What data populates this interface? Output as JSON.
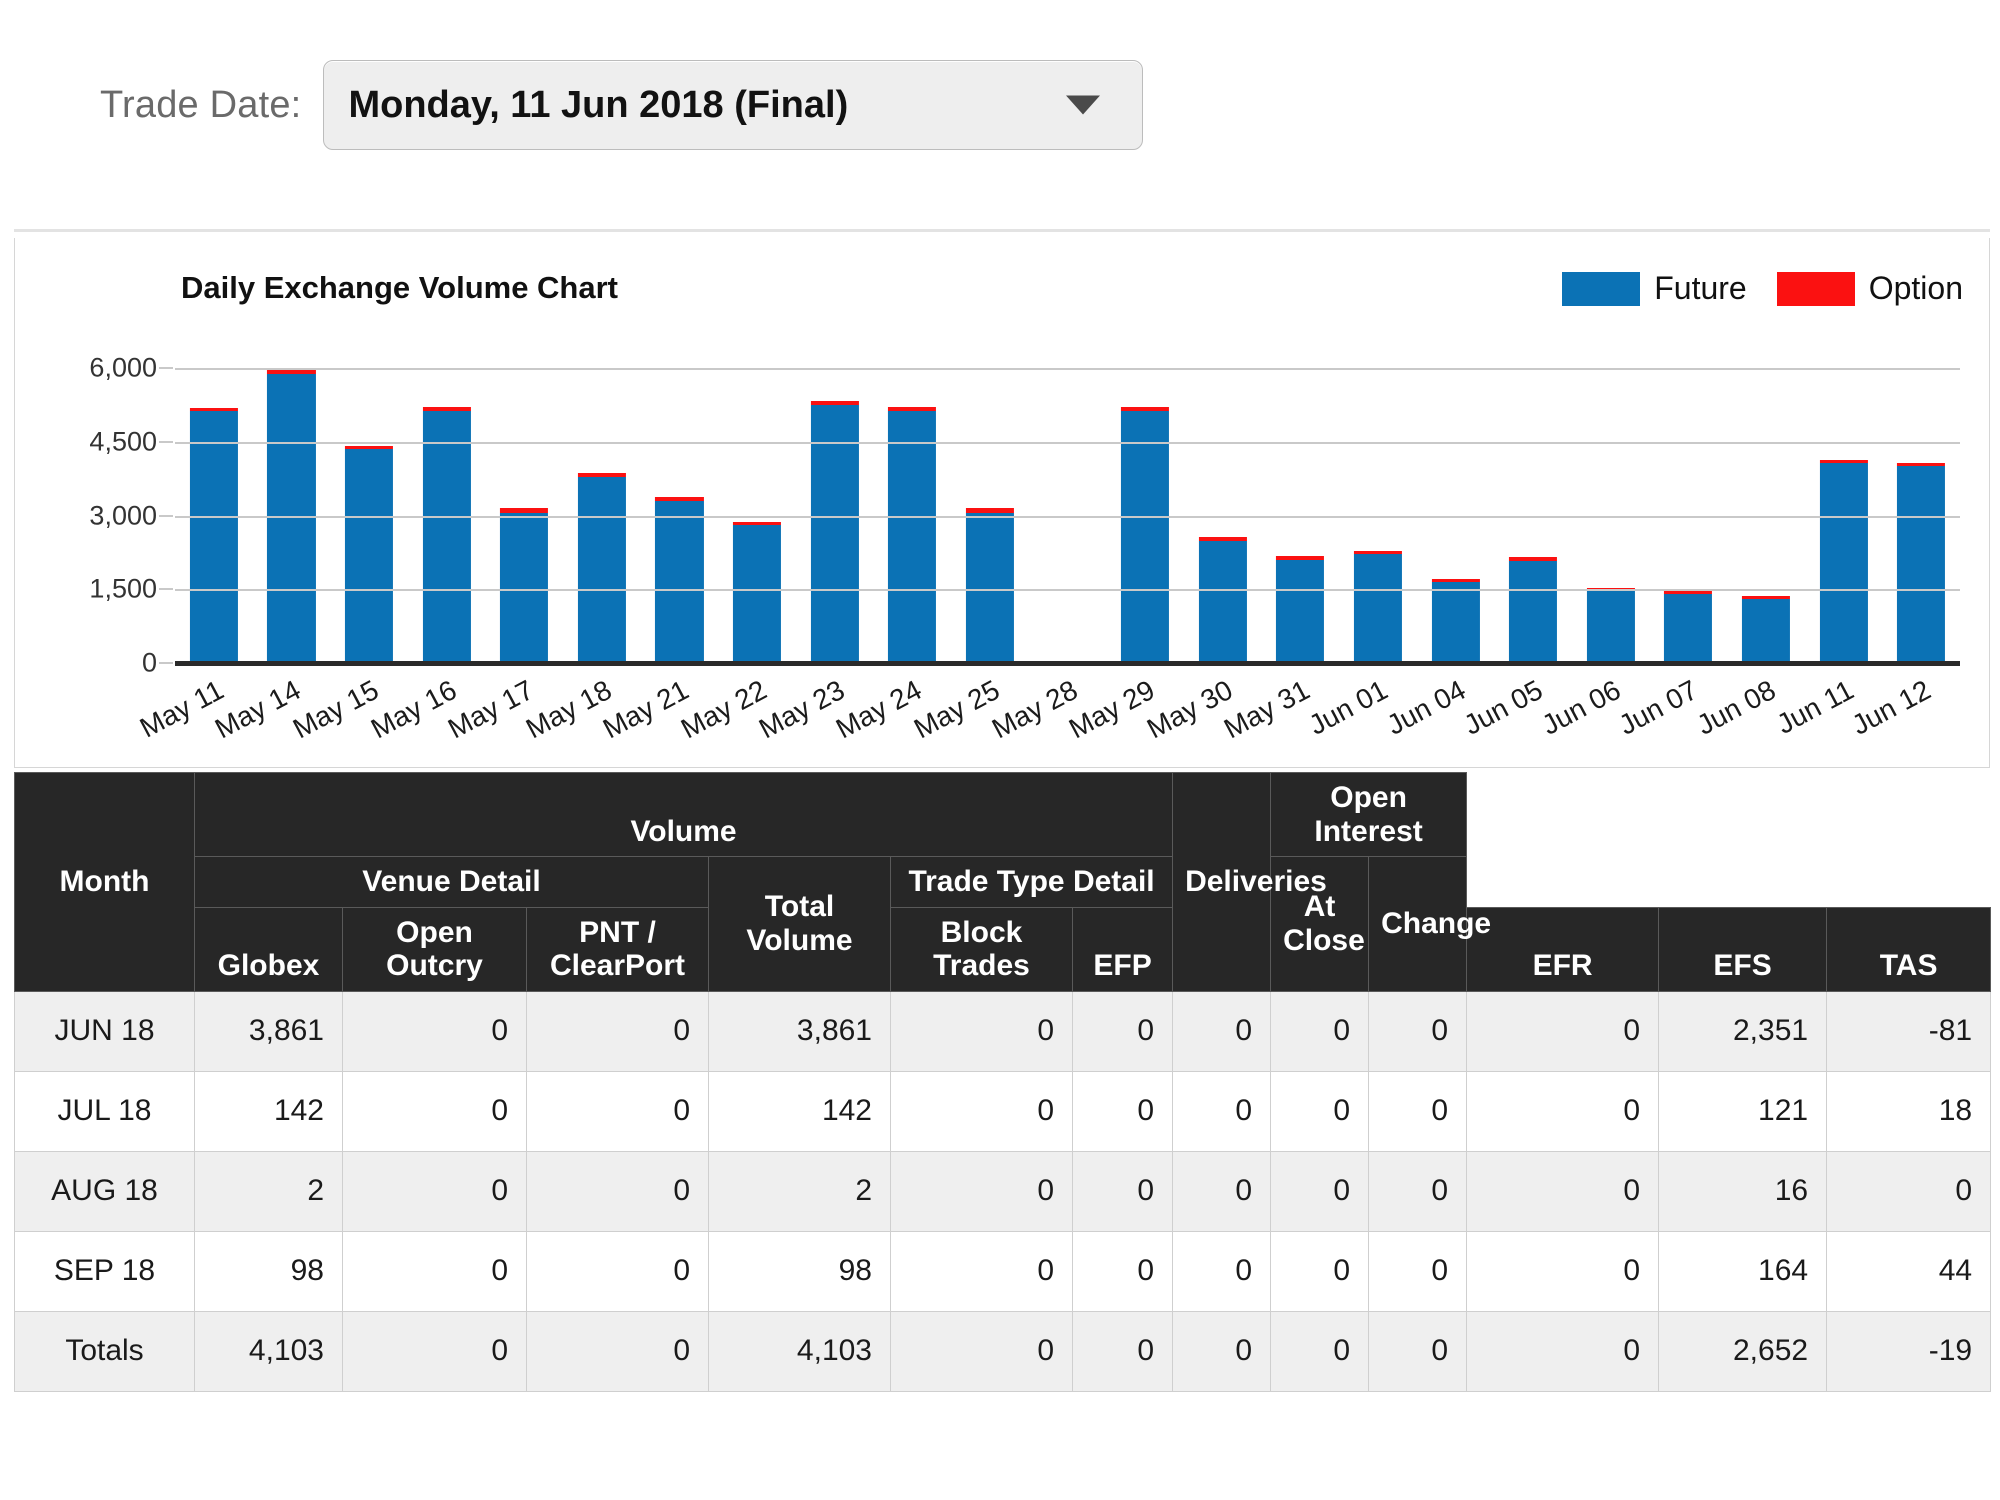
{
  "toolbar": {
    "trade_date_label": "Trade Date:",
    "selected_date": "Monday, 11 Jun 2018 (Final)",
    "caret_icon": "chevron-down-icon"
  },
  "chart_data": {
    "type": "bar",
    "title": "Daily Exchange Volume Chart",
    "xlabel": "",
    "ylabel": "",
    "ylim": [
      0,
      6000
    ],
    "yticks": [
      "6,000",
      "4,500",
      "3,000",
      "1,500",
      "0"
    ],
    "ytick_values": [
      6000,
      4500,
      3000,
      1500,
      0
    ],
    "grid": true,
    "stacked": true,
    "legend_position": "top-right",
    "categories": [
      "May 11",
      "May 14",
      "May 15",
      "May 16",
      "May 17",
      "May 18",
      "May 21",
      "May 22",
      "May 23",
      "May 24",
      "May 25",
      "May 28",
      "May 29",
      "May 30",
      "May 31",
      "Jun 01",
      "Jun 04",
      "Jun 05",
      "Jun 06",
      "Jun 07",
      "Jun 08",
      "Jun 11",
      "Jun 12"
    ],
    "series": [
      {
        "name": "Future",
        "color": "#0b72b5",
        "values": [
          5120,
          5880,
          4350,
          5120,
          3060,
          3780,
          3290,
          2800,
          5240,
          5120,
          3060,
          0,
          5120,
          2490,
          2100,
          2220,
          1640,
          2080,
          1460,
          1400,
          1300,
          4070,
          4010
        ]
      },
      {
        "name": "Option",
        "color": "#fb1111",
        "values": [
          65,
          80,
          60,
          85,
          85,
          85,
          80,
          60,
          80,
          80,
          100,
          0,
          80,
          80,
          80,
          65,
          65,
          80,
          60,
          60,
          60,
          60,
          60
        ]
      }
    ],
    "totals": [
      5185,
      5960,
      4410,
      5205,
      3145,
      3865,
      3370,
      2860,
      5320,
      5200,
      3160,
      0,
      5200,
      2570,
      2180,
      2285,
      1705,
      2160,
      1520,
      1460,
      1360,
      4130,
      4070
    ]
  },
  "legend": [
    {
      "label": "Future",
      "color": "#0b72b5"
    },
    {
      "label": "Option",
      "color": "#fb1111"
    }
  ],
  "table": {
    "group_headers": [
      {
        "label": "Volume"
      },
      {
        "label": "Open Interest"
      }
    ],
    "sub_headers": [
      {
        "label": "Venue Detail"
      },
      {
        "label": "Trade Type Detail"
      }
    ],
    "columns": [
      {
        "key": "month",
        "label": "Month"
      },
      {
        "key": "globex",
        "label": "Globex"
      },
      {
        "key": "outcry",
        "label": "Open Outcry"
      },
      {
        "key": "pnt",
        "label": "PNT / ClearPort"
      },
      {
        "key": "total",
        "label": "Total Volume"
      },
      {
        "key": "block",
        "label": "Block Trades"
      },
      {
        "key": "efp",
        "label": "EFP"
      },
      {
        "key": "efr",
        "label": "EFR"
      },
      {
        "key": "efs",
        "label": "EFS"
      },
      {
        "key": "tas",
        "label": "TAS"
      },
      {
        "key": "deliv",
        "label": "Deliveries"
      },
      {
        "key": "atclose",
        "label": "At Close"
      },
      {
        "key": "change",
        "label": "Change"
      }
    ],
    "column_labels": {
      "month": "Month",
      "globex": "Globex",
      "outcry_l1": "Open",
      "outcry_l2": "Outcry",
      "pnt_l1": "PNT /",
      "pnt_l2": "ClearPort",
      "total_l1": "Total",
      "total_l2": "Volume",
      "block_l1": "Block",
      "block_l2": "Trades",
      "efp": "EFP",
      "efr": "EFR",
      "efs": "EFS",
      "tas": "TAS",
      "deliveries": "Deliveries",
      "atclose_l1": "At",
      "atclose_l2": "Close",
      "change": "Change"
    },
    "rows": [
      {
        "month": "JUN 18",
        "globex": "3,861",
        "outcry": "0",
        "pnt": "0",
        "total": "3,861",
        "block": "0",
        "efp": "0",
        "efr": "0",
        "efs": "0",
        "tas": "0",
        "deliv": "0",
        "atclose": "2,351",
        "change": "-81"
      },
      {
        "month": "JUL 18",
        "globex": "142",
        "outcry": "0",
        "pnt": "0",
        "total": "142",
        "block": "0",
        "efp": "0",
        "efr": "0",
        "efs": "0",
        "tas": "0",
        "deliv": "0",
        "atclose": "121",
        "change": "18"
      },
      {
        "month": "AUG 18",
        "globex": "2",
        "outcry": "0",
        "pnt": "0",
        "total": "2",
        "block": "0",
        "efp": "0",
        "efr": "0",
        "efs": "0",
        "tas": "0",
        "deliv": "0",
        "atclose": "16",
        "change": "0"
      },
      {
        "month": "SEP 18",
        "globex": "98",
        "outcry": "0",
        "pnt": "0",
        "total": "98",
        "block": "0",
        "efp": "0",
        "efr": "0",
        "efs": "0",
        "tas": "0",
        "deliv": "0",
        "atclose": "164",
        "change": "44"
      },
      {
        "month": "Totals",
        "globex": "4,103",
        "outcry": "0",
        "pnt": "0",
        "total": "4,103",
        "block": "0",
        "efp": "0",
        "efr": "0",
        "efs": "0",
        "tas": "0",
        "deliv": "0",
        "atclose": "2,652",
        "change": "-19"
      }
    ]
  }
}
